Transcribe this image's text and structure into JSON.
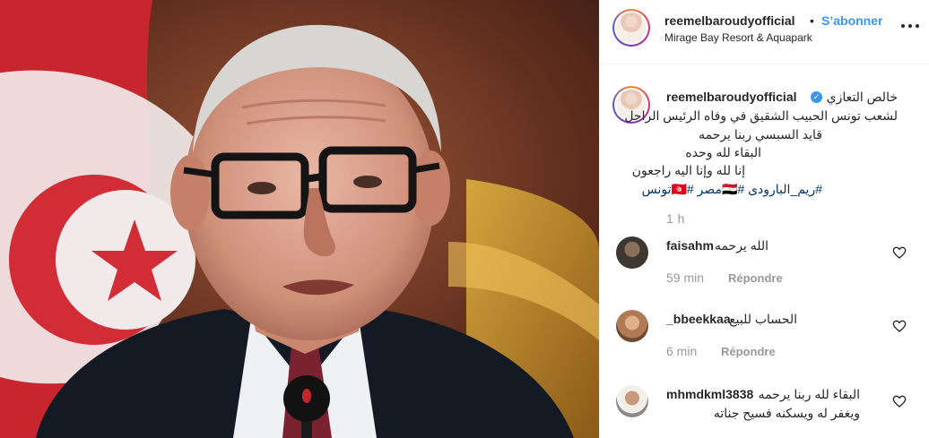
{
  "post": {
    "image_alt": "Portrait photo of an elderly man in glasses speaking at a microphone, red flag in background"
  },
  "header": {
    "username": "reemelbaroudyofficial",
    "dot": "•",
    "follow_label": "S’abonner",
    "location": "Mirage Bay Resort & Aquapark"
  },
  "caption": {
    "username": "reemelbaroudyofficial",
    "verified_mark": "✓",
    "lines": [
      "خالص التعازي",
      "لشعب تونس الحبيب الشقيق في وفاه الرئيس الراحل",
      "قايد السبسي ربنا يرحمه",
      "البقاء لله وحده",
      "إنا لله وإنا اليه راجعون"
    ],
    "hashtags": "#ريم_البارودى #🇪🇬مصر #🇹🇳تونس",
    "time": "1 h"
  },
  "comments": [
    {
      "username": "faisahm",
      "text": "الله يرحمه",
      "time": "59 min",
      "reply_label": "Répondre"
    },
    {
      "username": "_bbeekkaa",
      "text": "الحساب للبيع",
      "time": "6 min",
      "reply_label": "Répondre"
    },
    {
      "username": "mhmdkml3838",
      "text": "البقاء لله ربنا يرحمه",
      "text2": "ويغفر له ويسكنه فسيح جناته"
    }
  ],
  "colors": {
    "link_blue": "#3897f0",
    "hashtag_blue": "#003569",
    "meta_gray": "#999999",
    "divider": "#efefef"
  },
  "icons": {
    "verified": "verified-badge-icon",
    "more": "more-options-icon",
    "like": "heart-outline-icon"
  }
}
